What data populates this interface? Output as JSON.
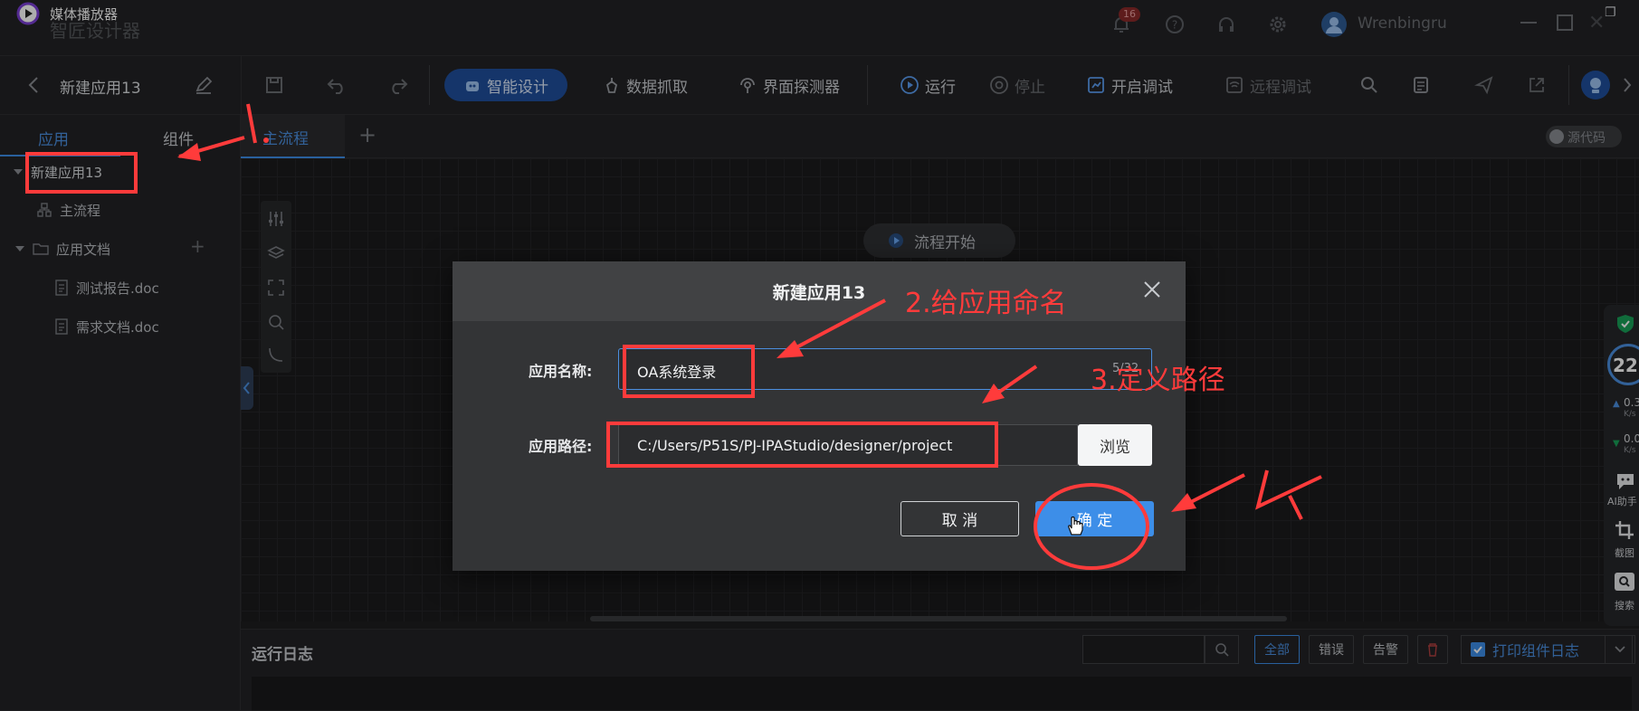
{
  "window": {
    "app_title": "媒体播放器",
    "app_title_behind": "智匠设计器",
    "notification_count": "16",
    "username": "Wrenbingru"
  },
  "toolbar": {
    "project_name": "新建应用13",
    "smart_design": "智能设计",
    "data_capture": "数据抓取",
    "ui_detector": "界面探测器",
    "run": "运行",
    "stop": "停止",
    "start_debug": "开启调试",
    "remote_debug": "远程调试"
  },
  "left_panel": {
    "tab_app": "应用",
    "tab_components": "组件",
    "tree": {
      "root": "新建应用13",
      "main_flow": "主流程",
      "app_docs": "应用文档",
      "doc1": "测试报告.doc",
      "doc2": "需求文档.doc"
    }
  },
  "editor": {
    "tab_main_flow": "主流程",
    "source_toggle": "源代码",
    "flow_start": "流程开始"
  },
  "dialog": {
    "title": "新建应用13",
    "name_label": "应用名称:",
    "name_value": "OA系统登录",
    "name_counter": "5/32",
    "path_label": "应用路径:",
    "path_value": "C:/Users/P51S/PJ-IPAStudio/designer/project",
    "browse": "浏览",
    "cancel": "取 消",
    "confirm": "确 定"
  },
  "log_panel": {
    "title": "运行日志",
    "all": "全部",
    "error": "错误",
    "warning": "告警",
    "print_component_log": "打印组件日志"
  },
  "right_float": {
    "percent": "22",
    "up_speed": "0.3",
    "up_unit": "K/s",
    "down_speed": "0.0",
    "down_unit": "K/s",
    "ai_assistant": "AI助手",
    "screenshot": "截图",
    "search": "搜索"
  },
  "annotations": {
    "step1": "1.",
    "step2": "2.给应用命名",
    "step3": "3.定义路径",
    "step4": "4."
  },
  "colors": {
    "accent_blue": "#3d8ee8",
    "annotation_red": "#ff3b3b",
    "background": "#1e1e1f"
  }
}
